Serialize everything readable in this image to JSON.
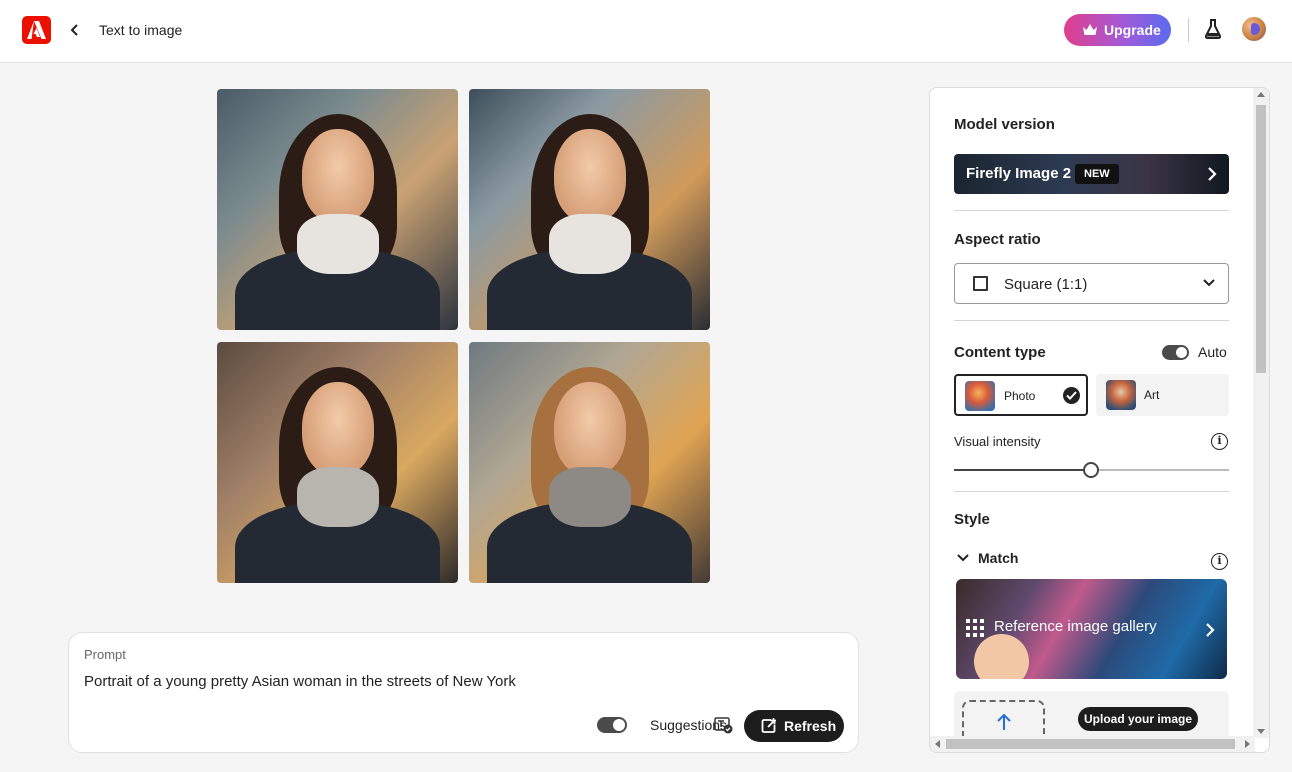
{
  "header": {
    "title": "Text to image",
    "upgrade_label": "Upgrade",
    "logo_icon": "adobe-logo-icon",
    "back_icon": "chevron-left-icon",
    "labs_icon": "beaker-icon",
    "brand_color": "#eb1000"
  },
  "gallery": {
    "images": [
      {
        "alt": "Portrait of a young woman in a city street, wearing a dark jacket and white turtleneck"
      },
      {
        "alt": "Portrait of a young woman in a city street, wearing a leather jacket and white turtleneck"
      },
      {
        "alt": "Portrait of a young woman in a city street, wearing a leather jacket and grey sweater"
      },
      {
        "alt": "Portrait of a young woman in a city street, wearing a coat and scarf"
      }
    ]
  },
  "prompt": {
    "label": "Prompt",
    "text": "Portrait of a young pretty Asian woman in the streets of New York",
    "suggestions_label": "Suggestions",
    "suggestions_on": true,
    "refresh_label": "Refresh"
  },
  "panel": {
    "model": {
      "title": "Model version",
      "name": "Firefly Image 2",
      "badge": "NEW"
    },
    "aspect": {
      "title": "Aspect ratio",
      "selected": "Square (1:1)"
    },
    "content_type": {
      "title": "Content type",
      "auto_label": "Auto",
      "auto_on": true,
      "options": [
        {
          "label": "Photo",
          "selected": true
        },
        {
          "label": "Art",
          "selected": false
        }
      ]
    },
    "visual_intensity": {
      "label": "Visual intensity",
      "value_fraction": 0.5
    },
    "style": {
      "title": "Style",
      "match_label": "Match",
      "gallery_label": "Reference image gallery",
      "upload_label": "Upload your image"
    }
  }
}
